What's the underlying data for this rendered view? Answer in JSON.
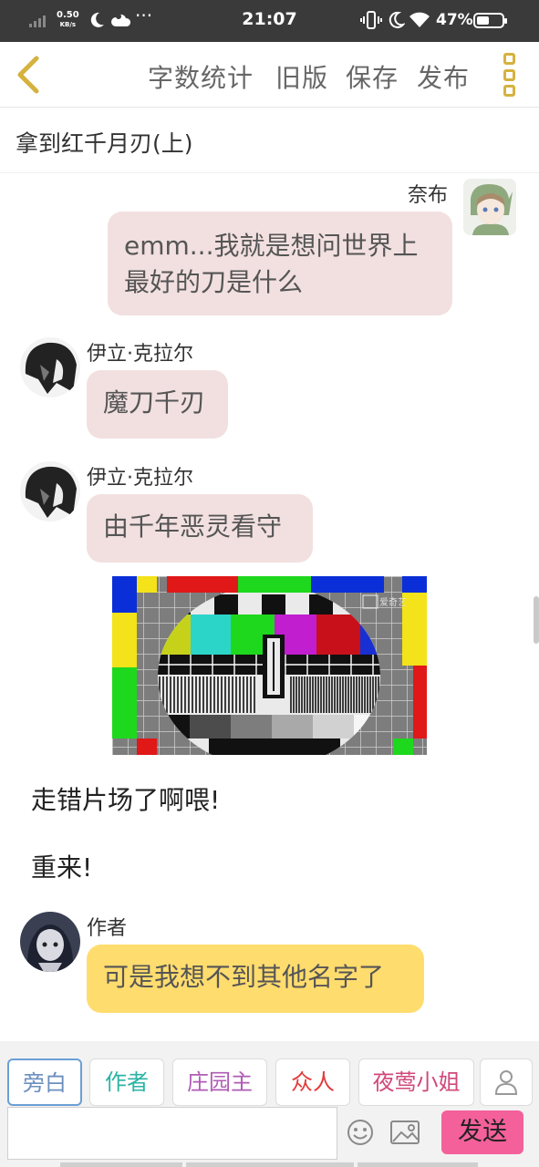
{
  "status_bar": {
    "net_speed_value": "0.50",
    "net_speed_unit": "KB/s",
    "more_dots": "···",
    "time": "21:07",
    "battery_percent": "47%"
  },
  "toolbar": {
    "word_count": "字数统计",
    "old_version": "旧版",
    "save": "保存",
    "publish": "发布"
  },
  "story": {
    "title": "拿到红千月刃(上)"
  },
  "messages": [
    {
      "speaker": "奈布",
      "text_line1": "emm...我就是想问世界上",
      "text_line2": "最好的刀是什么"
    },
    {
      "speaker": "伊立·克拉尔",
      "text": "魔刀千刃"
    },
    {
      "speaker": "伊立·克拉尔",
      "text": "由千年恶灵看守"
    },
    {
      "narration": "走错片场了啊喂!"
    },
    {
      "narration": "重来!"
    },
    {
      "speaker": "作者",
      "text": "可是我想不到其他名字了"
    }
  ],
  "image_watermark": "爱奇艺",
  "roles": [
    "旁白",
    "作者",
    "庄园主",
    "众人",
    "夜莺小姐"
  ],
  "role_colors": {
    "旁白": "#6b8fbf",
    "作者": "#2bb3a5",
    "庄园主": "#b05bb5",
    "众人": "#e23b3b",
    "夜莺小姐": "#d0487a"
  },
  "composer": {
    "input_value": "",
    "send_label": "发送"
  },
  "icons": [
    "back-arrow-icon",
    "more-menu-icon",
    "person-add-icon",
    "emoji-icon",
    "image-icon",
    "moon-icon",
    "cloud-icon",
    "vibrate-icon",
    "wifi-icon",
    "battery-icon",
    "signal-icon"
  ]
}
